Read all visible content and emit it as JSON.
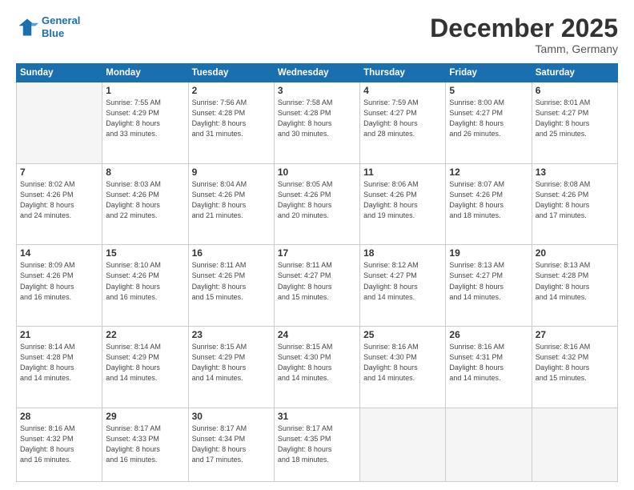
{
  "header": {
    "logo_line1": "General",
    "logo_line2": "Blue",
    "month": "December 2025",
    "location": "Tamm, Germany"
  },
  "weekdays": [
    "Sunday",
    "Monday",
    "Tuesday",
    "Wednesday",
    "Thursday",
    "Friday",
    "Saturday"
  ],
  "weeks": [
    [
      {
        "day": "",
        "info": ""
      },
      {
        "day": "1",
        "info": "Sunrise: 7:55 AM\nSunset: 4:29 PM\nDaylight: 8 hours\nand 33 minutes."
      },
      {
        "day": "2",
        "info": "Sunrise: 7:56 AM\nSunset: 4:28 PM\nDaylight: 8 hours\nand 31 minutes."
      },
      {
        "day": "3",
        "info": "Sunrise: 7:58 AM\nSunset: 4:28 PM\nDaylight: 8 hours\nand 30 minutes."
      },
      {
        "day": "4",
        "info": "Sunrise: 7:59 AM\nSunset: 4:27 PM\nDaylight: 8 hours\nand 28 minutes."
      },
      {
        "day": "5",
        "info": "Sunrise: 8:00 AM\nSunset: 4:27 PM\nDaylight: 8 hours\nand 26 minutes."
      },
      {
        "day": "6",
        "info": "Sunrise: 8:01 AM\nSunset: 4:27 PM\nDaylight: 8 hours\nand 25 minutes."
      }
    ],
    [
      {
        "day": "7",
        "info": "Sunrise: 8:02 AM\nSunset: 4:26 PM\nDaylight: 8 hours\nand 24 minutes."
      },
      {
        "day": "8",
        "info": "Sunrise: 8:03 AM\nSunset: 4:26 PM\nDaylight: 8 hours\nand 22 minutes."
      },
      {
        "day": "9",
        "info": "Sunrise: 8:04 AM\nSunset: 4:26 PM\nDaylight: 8 hours\nand 21 minutes."
      },
      {
        "day": "10",
        "info": "Sunrise: 8:05 AM\nSunset: 4:26 PM\nDaylight: 8 hours\nand 20 minutes."
      },
      {
        "day": "11",
        "info": "Sunrise: 8:06 AM\nSunset: 4:26 PM\nDaylight: 8 hours\nand 19 minutes."
      },
      {
        "day": "12",
        "info": "Sunrise: 8:07 AM\nSunset: 4:26 PM\nDaylight: 8 hours\nand 18 minutes."
      },
      {
        "day": "13",
        "info": "Sunrise: 8:08 AM\nSunset: 4:26 PM\nDaylight: 8 hours\nand 17 minutes."
      }
    ],
    [
      {
        "day": "14",
        "info": "Sunrise: 8:09 AM\nSunset: 4:26 PM\nDaylight: 8 hours\nand 16 minutes."
      },
      {
        "day": "15",
        "info": "Sunrise: 8:10 AM\nSunset: 4:26 PM\nDaylight: 8 hours\nand 16 minutes."
      },
      {
        "day": "16",
        "info": "Sunrise: 8:11 AM\nSunset: 4:26 PM\nDaylight: 8 hours\nand 15 minutes."
      },
      {
        "day": "17",
        "info": "Sunrise: 8:11 AM\nSunset: 4:27 PM\nDaylight: 8 hours\nand 15 minutes."
      },
      {
        "day": "18",
        "info": "Sunrise: 8:12 AM\nSunset: 4:27 PM\nDaylight: 8 hours\nand 14 minutes."
      },
      {
        "day": "19",
        "info": "Sunrise: 8:13 AM\nSunset: 4:27 PM\nDaylight: 8 hours\nand 14 minutes."
      },
      {
        "day": "20",
        "info": "Sunrise: 8:13 AM\nSunset: 4:28 PM\nDaylight: 8 hours\nand 14 minutes."
      }
    ],
    [
      {
        "day": "21",
        "info": "Sunrise: 8:14 AM\nSunset: 4:28 PM\nDaylight: 8 hours\nand 14 minutes."
      },
      {
        "day": "22",
        "info": "Sunrise: 8:14 AM\nSunset: 4:29 PM\nDaylight: 8 hours\nand 14 minutes."
      },
      {
        "day": "23",
        "info": "Sunrise: 8:15 AM\nSunset: 4:29 PM\nDaylight: 8 hours\nand 14 minutes."
      },
      {
        "day": "24",
        "info": "Sunrise: 8:15 AM\nSunset: 4:30 PM\nDaylight: 8 hours\nand 14 minutes."
      },
      {
        "day": "25",
        "info": "Sunrise: 8:16 AM\nSunset: 4:30 PM\nDaylight: 8 hours\nand 14 minutes."
      },
      {
        "day": "26",
        "info": "Sunrise: 8:16 AM\nSunset: 4:31 PM\nDaylight: 8 hours\nand 14 minutes."
      },
      {
        "day": "27",
        "info": "Sunrise: 8:16 AM\nSunset: 4:32 PM\nDaylight: 8 hours\nand 15 minutes."
      }
    ],
    [
      {
        "day": "28",
        "info": "Sunrise: 8:16 AM\nSunset: 4:32 PM\nDaylight: 8 hours\nand 16 minutes."
      },
      {
        "day": "29",
        "info": "Sunrise: 8:17 AM\nSunset: 4:33 PM\nDaylight: 8 hours\nand 16 minutes."
      },
      {
        "day": "30",
        "info": "Sunrise: 8:17 AM\nSunset: 4:34 PM\nDaylight: 8 hours\nand 17 minutes."
      },
      {
        "day": "31",
        "info": "Sunrise: 8:17 AM\nSunset: 4:35 PM\nDaylight: 8 hours\nand 18 minutes."
      },
      {
        "day": "",
        "info": ""
      },
      {
        "day": "",
        "info": ""
      },
      {
        "day": "",
        "info": ""
      }
    ]
  ]
}
